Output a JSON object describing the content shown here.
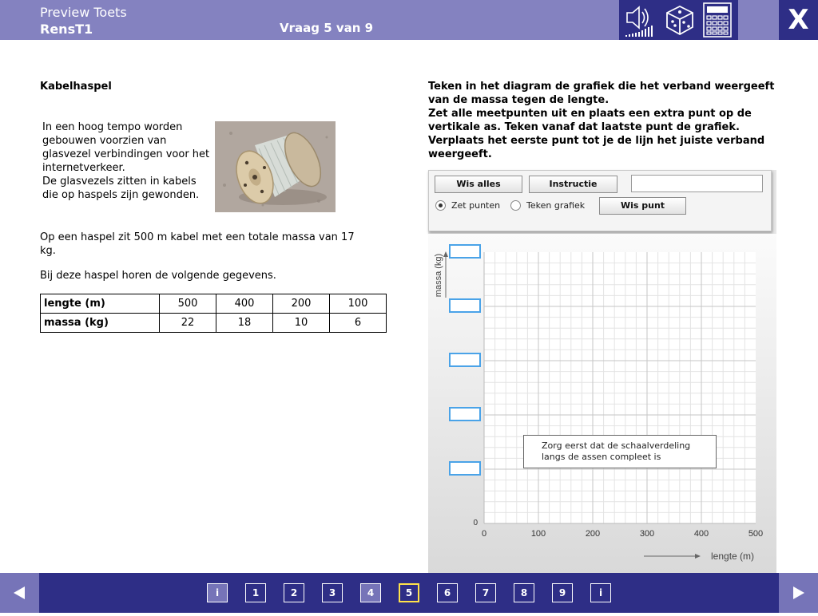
{
  "header": {
    "app_title": "Preview Toets",
    "test_name": "RensT1",
    "question_counter": "Vraag 5 van 9",
    "close_label": "X",
    "tools": [
      "speaker-icon",
      "dice-icon",
      "calculator-icon"
    ]
  },
  "question": {
    "title": "Kabelhaspel",
    "intro_lines": [
      "In een hoog tempo worden gebouwen voorzien van glasvezel verbindingen voor het internetverkeer.",
      "De glasvezels zitten in kabels die op haspels zijn gewonden."
    ],
    "paragraph1": "Op een haspel zit 500 m kabel met een totale massa van 17 kg.",
    "paragraph2": "Bij deze haspel horen de volgende gegevens.",
    "table": {
      "row1_label": "lengte (m)",
      "row1": [
        "500",
        "400",
        "200",
        "100"
      ],
      "row2_label": "massa (kg)",
      "row2": [
        "22",
        "18",
        "10",
        "6"
      ]
    }
  },
  "task": {
    "instructions": [
      "Teken in het diagram de grafiek die het verband weergeeft van de massa tegen de lengte.",
      "Zet alle meetpunten uit en plaats een extra punt op de vertikale as. Teken vanaf dat laatste punt de grafiek.",
      "Verplaats het eerste punt tot je de lijn het juiste verband weergeeft."
    ]
  },
  "tool_panel": {
    "clear_all": "Wis alles",
    "instruction": "Instructie",
    "answer_value": "",
    "mode_points": "Zet punten",
    "mode_graph": "Teken grafiek",
    "selected_mode": "Zet punten",
    "delete_point": "Wis punt"
  },
  "chart_data": {
    "type": "scatter",
    "xlabel": "lengte (m)",
    "ylabel": "massa (kg)",
    "x_ticks": [
      "0",
      "100",
      "200",
      "300",
      "400",
      "500"
    ],
    "xlim": [
      0,
      500
    ],
    "y_tick_zero": "0",
    "y_tick_inputs": 5,
    "grid": true,
    "series": [],
    "hint": "Zorg eerst dat de schaalverdeling langs de assen compleet is"
  },
  "footer": {
    "pages": [
      {
        "label": "i",
        "state": "done"
      },
      {
        "label": "1",
        "state": "normal"
      },
      {
        "label": "2",
        "state": "normal"
      },
      {
        "label": "3",
        "state": "normal"
      },
      {
        "label": "4",
        "state": "done"
      },
      {
        "label": "5",
        "state": "current"
      },
      {
        "label": "6",
        "state": "normal"
      },
      {
        "label": "7",
        "state": "normal"
      },
      {
        "label": "8",
        "state": "normal"
      },
      {
        "label": "9",
        "state": "normal"
      },
      {
        "label": "i",
        "state": "normal"
      }
    ]
  }
}
